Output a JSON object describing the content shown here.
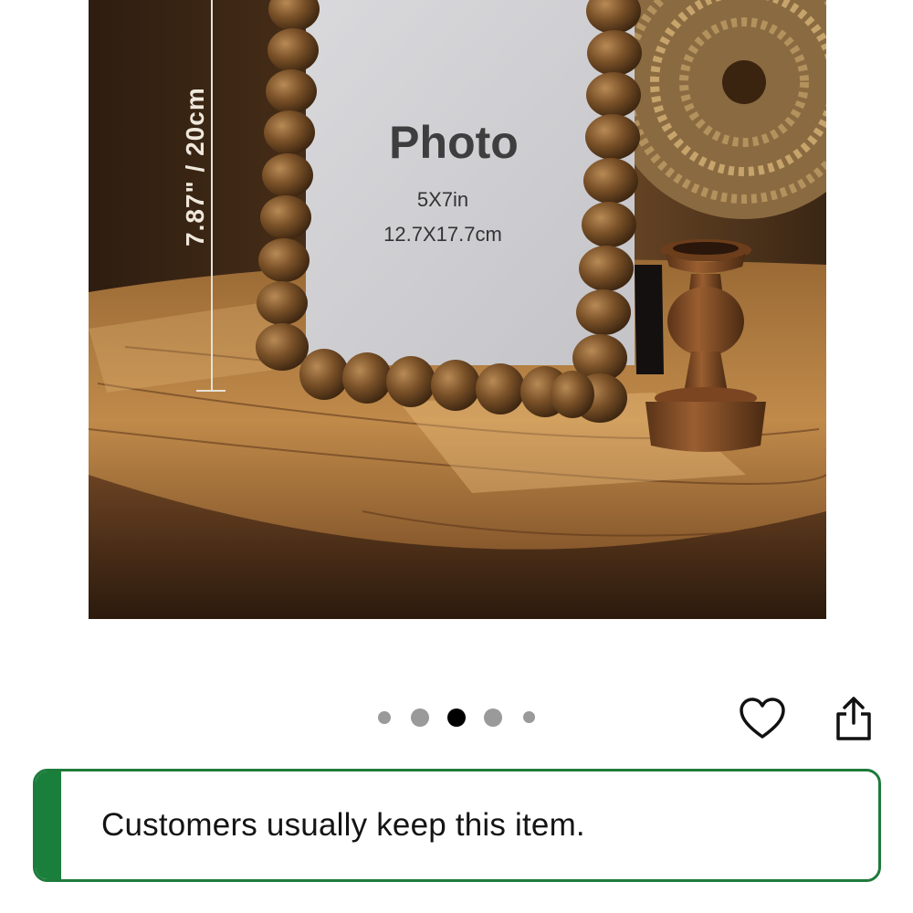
{
  "product_image": {
    "frame_title": "Photo",
    "frame_size_in": "5X7in",
    "frame_size_cm": "12.7X17.7cm",
    "height_dimension": "7.87\" / 20cm"
  },
  "carousel": {
    "total_images": 5,
    "active_index": 2
  },
  "actions": {
    "favorite_icon": "heart-icon",
    "share_icon": "share-icon"
  },
  "banner": {
    "text": "Customers usually keep this item.",
    "accent_color": "#1a7f3a"
  }
}
